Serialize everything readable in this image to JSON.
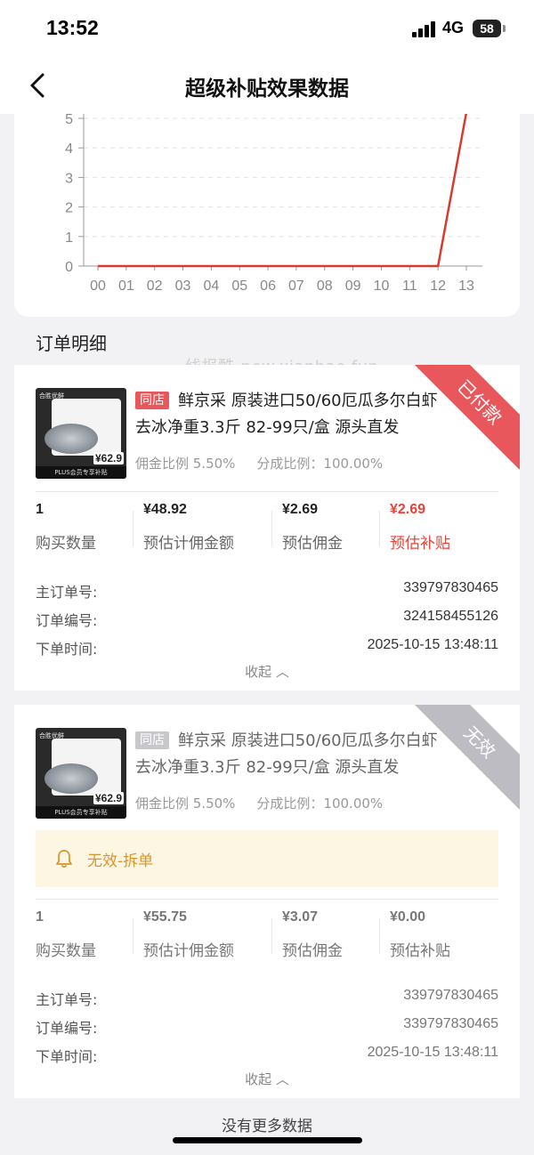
{
  "status_bar": {
    "time": "13:52",
    "network": "4G",
    "battery": "58"
  },
  "nav": {
    "title": "超级补贴效果数据"
  },
  "chart_data": {
    "type": "line",
    "x": [
      "00",
      "01",
      "02",
      "03",
      "04",
      "05",
      "06",
      "07",
      "08",
      "09",
      "10",
      "11",
      "12",
      "13"
    ],
    "y_ticks": [
      "0",
      "1",
      "2",
      "3",
      "4",
      "5"
    ],
    "ylim": [
      0,
      5
    ],
    "series": [
      {
        "values": [
          0,
          0,
          0,
          0,
          0,
          0,
          0,
          0,
          0,
          0,
          0,
          0,
          0,
          5.2
        ]
      }
    ],
    "line_color": "#d93a2f",
    "grid": true,
    "title": "",
    "xlabel": "",
    "ylabel": ""
  },
  "section_title": "订单明细",
  "watermark": "线报酷-new.xianbao.fun",
  "orders": [
    {
      "status": "已付款",
      "thumb": {
        "brand": "合胜优鲜",
        "price": "¥62.9",
        "banner": "PLUS会员专享补贴"
      },
      "tag": "同店",
      "title": "鲜京采 原装进口50/60厄瓜多尔白虾 去冰净重3.3斤 82-99只/盒 源头直发",
      "commission_rate": "佣金比例 5.50%",
      "share_rate": "分成比例：100.00%",
      "stats": [
        {
          "value": "1",
          "label": "购买数量"
        },
        {
          "value": "¥48.92",
          "label": "预估计佣金额"
        },
        {
          "value": "¥2.69",
          "label": "预估佣金"
        },
        {
          "value": "¥2.69",
          "label": "预估补贴"
        }
      ],
      "details": [
        {
          "key": "主订单号:",
          "value": "339797830465"
        },
        {
          "key": "订单编号:",
          "value": "324158455126"
        },
        {
          "key": "下单时间:",
          "value": "2025-10-15 13:48:11"
        }
      ],
      "collapse": "收起 ︿"
    },
    {
      "status": "无效",
      "thumb": {
        "brand": "合胜优鲜",
        "price": "¥62.9",
        "banner": "PLUS会员专享补贴"
      },
      "tag": "同店",
      "title": "鲜京采 原装进口50/60厄瓜多尔白虾 去冰净重3.3斤 82-99只/盒 源头直发",
      "commission_rate": "佣金比例 5.50%",
      "share_rate": "分成比例：100.00%",
      "notice": "无效-拆单",
      "stats": [
        {
          "value": "1",
          "label": "购买数量"
        },
        {
          "value": "¥55.75",
          "label": "预估计佣金额"
        },
        {
          "value": "¥3.07",
          "label": "预估佣金"
        },
        {
          "value": "¥0.00",
          "label": "预估补贴"
        }
      ],
      "details": [
        {
          "key": "主订单号:",
          "value": "339797830465"
        },
        {
          "key": "订单编号:",
          "value": "339797830465"
        },
        {
          "key": "下单时间:",
          "value": "2025-10-15 13:48:11"
        }
      ],
      "collapse": "收起 ︿"
    }
  ],
  "footer": {
    "no_more": "没有更多数据"
  }
}
